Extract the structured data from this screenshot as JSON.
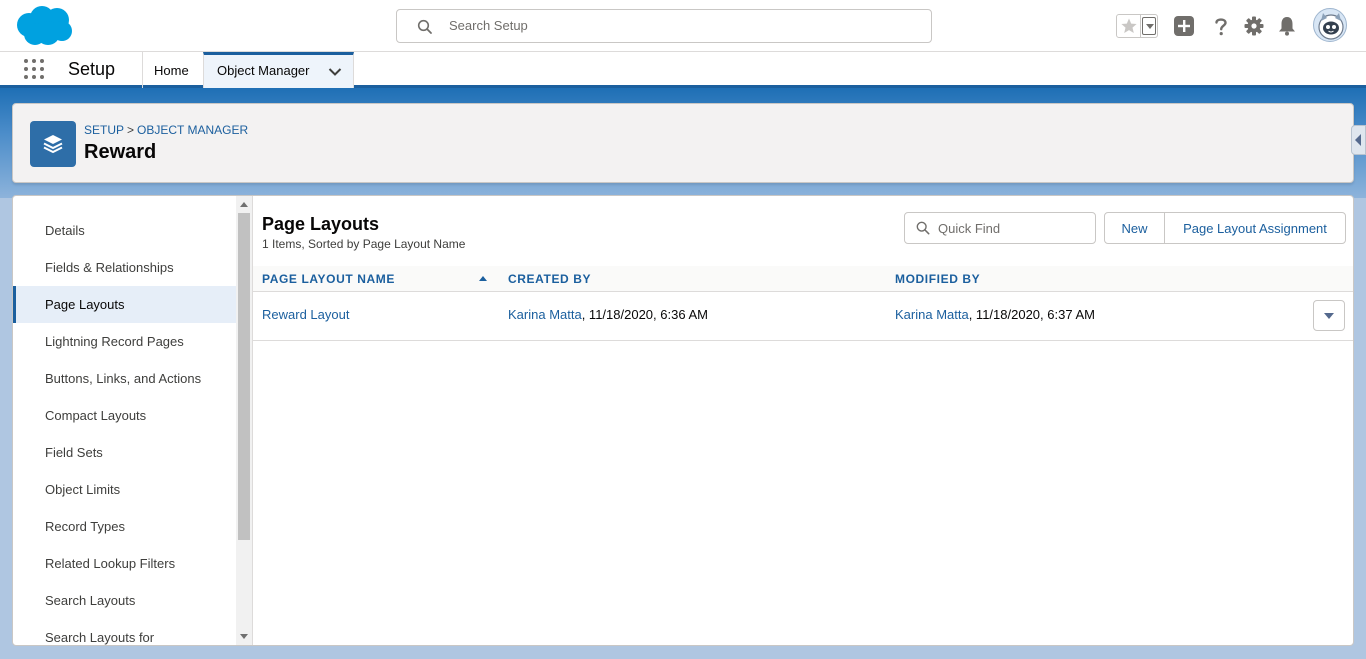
{
  "header": {
    "search_placeholder": "Search Setup",
    "icons": [
      "salesforce-cloud-logo",
      "search-icon",
      "star-icon",
      "add-icon",
      "help-icon",
      "gear-icon",
      "bell-icon",
      "avatar"
    ]
  },
  "context_nav": {
    "app_name": "Setup",
    "tabs": [
      {
        "label": "Home"
      },
      {
        "label": "Object Manager",
        "active": true
      }
    ]
  },
  "object_header": {
    "breadcrumb": [
      "SETUP",
      "OBJECT MANAGER"
    ],
    "breadcrumb_sep": ">",
    "title": "Reward",
    "icon": "layers-icon",
    "icon_color": "#2e6ea8"
  },
  "sidebar": {
    "items": [
      {
        "label": "Details"
      },
      {
        "label": "Fields & Relationships"
      },
      {
        "label": "Page Layouts",
        "active": true
      },
      {
        "label": "Lightning Record Pages"
      },
      {
        "label": "Buttons, Links, and Actions"
      },
      {
        "label": "Compact Layouts"
      },
      {
        "label": "Field Sets"
      },
      {
        "label": "Object Limits"
      },
      {
        "label": "Record Types"
      },
      {
        "label": "Related Lookup Filters"
      },
      {
        "label": "Search Layouts"
      },
      {
        "label": "Search Layouts for"
      }
    ]
  },
  "content": {
    "title": "Page Layouts",
    "subtitle": "1 Items, Sorted by Page Layout Name",
    "quick_find_placeholder": "Quick Find",
    "buttons": {
      "new": "New",
      "assignment": "Page Layout Assignment"
    },
    "columns": [
      "PAGE LAYOUT NAME",
      "CREATED BY",
      "MODIFIED BY"
    ],
    "rows": [
      {
        "name": "Reward Layout",
        "created_by_user": "Karina Matta",
        "created_by_date": ", 11/18/2020, 6:36 AM",
        "modified_by_user": "Karina Matta",
        "modified_by_date": ", 11/18/2020, 6:37 AM"
      }
    ]
  },
  "colors": {
    "brand_blue": "#1b5f9e",
    "salesforce_cloud": "#00a1e0"
  }
}
